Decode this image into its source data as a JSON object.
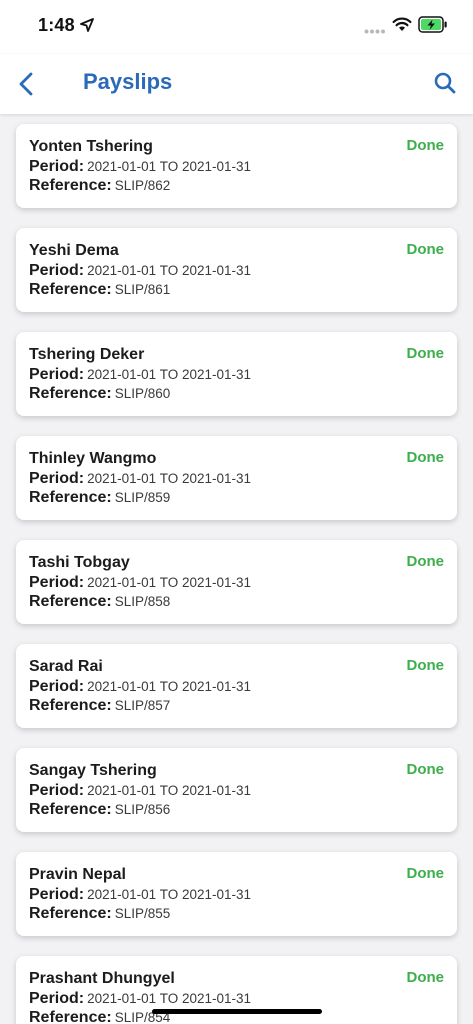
{
  "status_bar": {
    "time": "1:48",
    "icons": [
      "location-arrow-icon",
      "signal-dots-icon",
      "wifi-icon",
      "battery-charging-icon"
    ],
    "battery_color": "#4cd964"
  },
  "nav": {
    "title": "Payslips",
    "back_icon": "chevron-left-icon",
    "search_icon": "search-icon",
    "accent_color": "#2a6ab8"
  },
  "labels": {
    "period": "Period:",
    "reference": "Reference:"
  },
  "status_color": "#3cae4b",
  "payslips": [
    {
      "name": "Yonten Tshering",
      "status": "Done",
      "period": "2021-01-01 TO 2021-01-31",
      "reference": "SLIP/862"
    },
    {
      "name": "Yeshi Dema",
      "status": "Done",
      "period": "2021-01-01 TO 2021-01-31",
      "reference": "SLIP/861"
    },
    {
      "name": "Tshering Deker",
      "status": "Done",
      "period": "2021-01-01 TO 2021-01-31",
      "reference": "SLIP/860"
    },
    {
      "name": "Thinley Wangmo",
      "status": "Done",
      "period": "2021-01-01 TO 2021-01-31",
      "reference": "SLIP/859"
    },
    {
      "name": "Tashi Tobgay",
      "status": "Done",
      "period": "2021-01-01 TO 2021-01-31",
      "reference": "SLIP/858"
    },
    {
      "name": "Sarad Rai",
      "status": "Done",
      "period": "2021-01-01 TO 2021-01-31",
      "reference": "SLIP/857"
    },
    {
      "name": "Sangay Tshering",
      "status": "Done",
      "period": "2021-01-01 TO 2021-01-31",
      "reference": "SLIP/856"
    },
    {
      "name": "Pravin Nepal",
      "status": "Done",
      "period": "2021-01-01 TO 2021-01-31",
      "reference": "SLIP/855"
    },
    {
      "name": "Prashant Dhungyel",
      "status": "Done",
      "period": "2021-01-01 TO 2021-01-31",
      "reference": "SLIP/854"
    }
  ]
}
